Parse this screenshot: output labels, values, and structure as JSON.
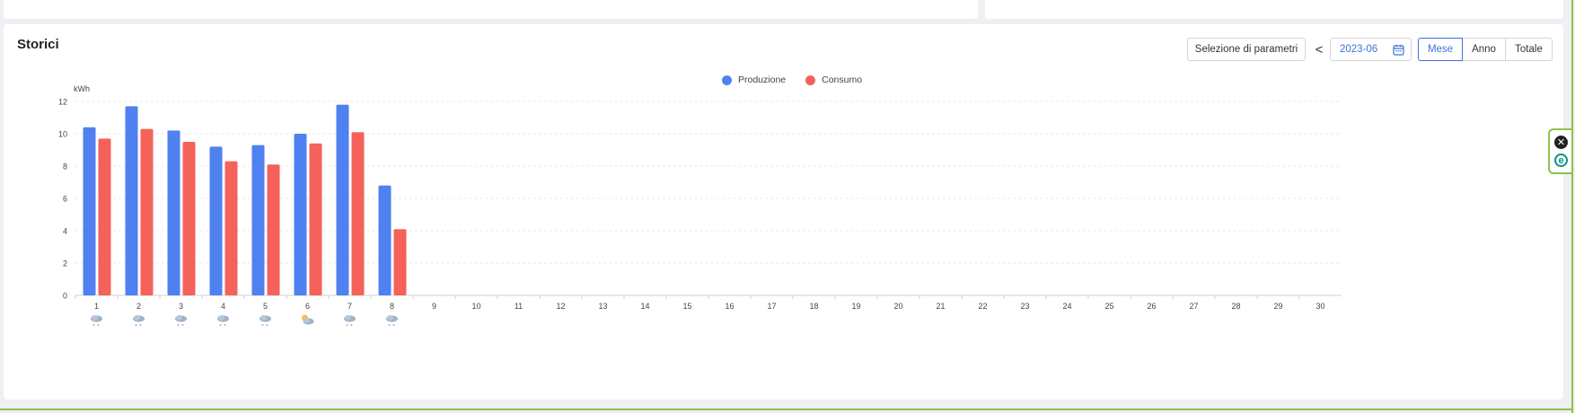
{
  "section": {
    "title": "Storici"
  },
  "controls": {
    "params_label": "Selezione di parametri",
    "prev_label": "<",
    "date_value": "2023-06",
    "period_tabs": [
      {
        "label": "Mese",
        "active": true
      },
      {
        "label": "Anno",
        "active": false
      },
      {
        "label": "Totale",
        "active": false
      }
    ]
  },
  "colors": {
    "produzione": "#4f81f0",
    "consumo": "#f4625a",
    "accent": "#3b73d8"
  },
  "chart_data": {
    "type": "bar",
    "ylabel": "kWh",
    "ylim": [
      0,
      12
    ],
    "yticks": [
      0,
      2,
      4,
      6,
      8,
      10,
      12
    ],
    "grid": true,
    "legend_position": "top-center",
    "categories": [
      "1",
      "2",
      "3",
      "4",
      "5",
      "6",
      "7",
      "8",
      "9",
      "10",
      "11",
      "12",
      "13",
      "14",
      "15",
      "16",
      "17",
      "18",
      "19",
      "20",
      "21",
      "22",
      "23",
      "24",
      "25",
      "26",
      "27",
      "28",
      "29",
      "30"
    ],
    "series": [
      {
        "name": "Produzione",
        "values": [
          10.4,
          11.7,
          10.2,
          9.2,
          9.3,
          10.0,
          11.8,
          6.8
        ]
      },
      {
        "name": "Consumo",
        "values": [
          9.7,
          10.3,
          9.5,
          8.3,
          8.1,
          9.4,
          10.1,
          4.1
        ]
      }
    ],
    "weather_icons": [
      "cloud-rain-icon",
      "cloud-rain-icon",
      "cloud-rain-icon",
      "cloud-rain-icon",
      "cloud-rain-icon",
      "partly-cloudy-icon",
      "cloud-rain-icon",
      "cloud-rain-icon"
    ]
  }
}
